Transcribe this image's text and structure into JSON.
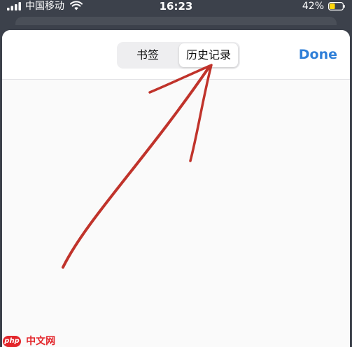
{
  "status_bar": {
    "carrier": "中国移动",
    "time": "16:23",
    "battery_percent": "42%",
    "battery_level": 0.42,
    "icons": [
      "signal-icon",
      "wifi-icon",
      "battery-icon"
    ],
    "battery_fill_color": "#ffd60a"
  },
  "sheet": {
    "segments": [
      {
        "label": "书签",
        "selected": false
      },
      {
        "label": "历史记录",
        "selected": true
      }
    ],
    "done_label": "Done",
    "accent_color": "#2f7fd8"
  },
  "annotation": {
    "icon": "red-arrow-annotation",
    "color": "#c0332b"
  },
  "watermark": {
    "logo": "php",
    "text": "中文网"
  }
}
